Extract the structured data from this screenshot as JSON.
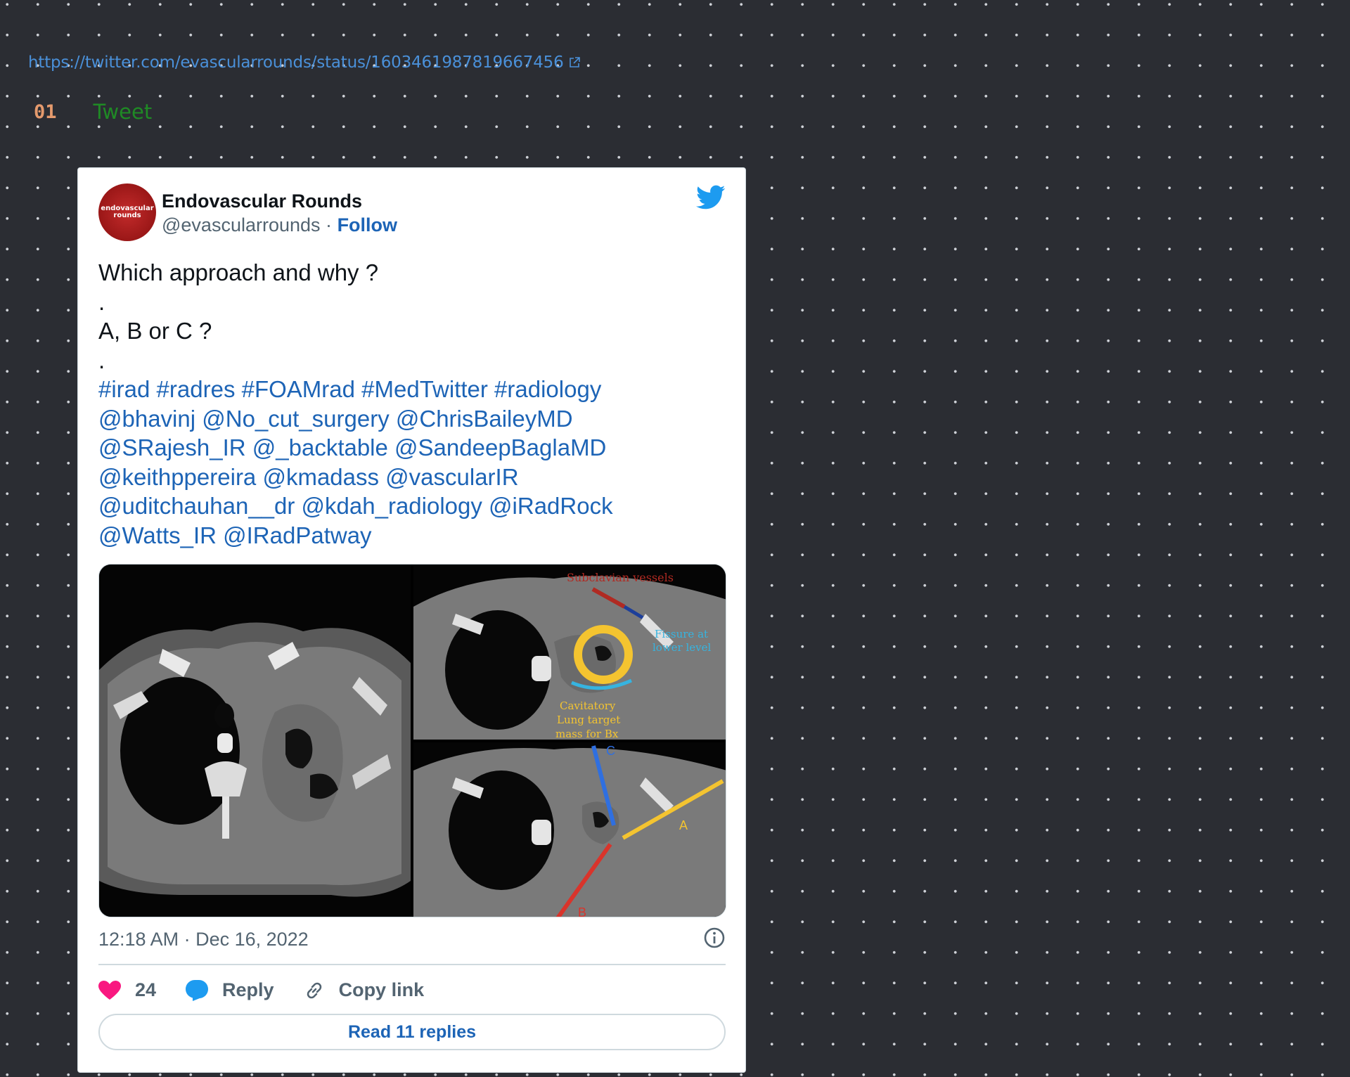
{
  "source_link": {
    "url_text": "https://twitter.com/evascularrounds/status/1603461987819667456"
  },
  "section": {
    "number": "01",
    "title": "Tweet"
  },
  "tweet": {
    "author_name": "Endovascular Rounds",
    "avatar_text_line1": "endovascular",
    "avatar_text_line2": "rounds",
    "handle": "@evascularrounds",
    "separator": "·",
    "follow_label": "Follow",
    "text_lines": [
      "Which approach and why ?",
      ".",
      "A, B or C ?",
      "."
    ],
    "mention_lines": [
      "#irad #radres #FOAMrad #MedTwitter #radiology",
      "@bhavinj @No_cut_surgery @ChrisBaileyMD",
      "@SRajesh_IR @_backtable @SandeepBaglaMD",
      "@keithppereira @kmadass @vascularIR",
      "@uditchauhan__dr @kdah_radiology @iRadRock",
      "@Watts_IR @IRadPatway"
    ],
    "image_labels": {
      "subclavian": "Subclavian vessels",
      "fissure_1": "Fissure at",
      "fissure_2": "lower level",
      "target_1": "Cavitatory",
      "target_2": "Lung target",
      "target_3": "mass for Bx",
      "approach_a": "A",
      "approach_b": "B",
      "approach_c": "C"
    },
    "timestamp": "12:18 AM · Dec 16, 2022",
    "like_count": "24",
    "reply_label": "Reply",
    "copy_link_label": "Copy link",
    "read_replies_label": "Read 11 replies"
  },
  "colors": {
    "link_blue": "#1d64b6",
    "twitter_blue": "#1d9bf0",
    "heart_pink": "#f91880",
    "heading_green": "#1f8a25",
    "heading_number": "#e59a6d",
    "label_yellow": "#f4c430",
    "label_red": "#d9342b",
    "label_cyan": "#36b4e0"
  },
  "icons": [
    "external-link-icon",
    "twitter-bird-icon",
    "info-icon",
    "heart-icon",
    "reply-bubble-icon",
    "copy-link-icon"
  ]
}
